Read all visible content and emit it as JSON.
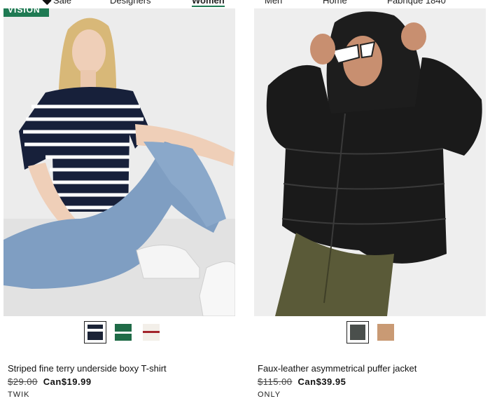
{
  "nav": {
    "items": [
      {
        "label": "Sale",
        "icon": "tag-icon"
      },
      {
        "label": "Designers"
      },
      {
        "label": "Women",
        "active": true
      },
      {
        "label": "Men"
      },
      {
        "label": "Home"
      },
      {
        "label": "Fabrique 1840"
      }
    ]
  },
  "colors": {
    "accent": "#1f7a53"
  },
  "products": [
    {
      "badge": "VISION",
      "title": "Striped fine terry underside boxy T-shirt",
      "old_price": "$29.00",
      "sale_price": "Can$19.99",
      "brand": "TWIK",
      "swatches": [
        {
          "color": "#1b2336",
          "stripe": "#ffffff",
          "selected": true
        },
        {
          "color": "#1f6b47",
          "stripe": "#ffffff",
          "selected": false
        },
        {
          "color": "#f3efe9",
          "stripe": "#a3242c",
          "selected": false
        }
      ]
    },
    {
      "title": "Faux-leather asymmetrical puffer jacket",
      "old_price": "$115.00",
      "sale_price": "Can$39.95",
      "brand": "ONLY",
      "swatches": [
        {
          "color": "#4a4f4c",
          "selected": true
        },
        {
          "color": "#c99a74",
          "selected": false
        }
      ]
    }
  ]
}
